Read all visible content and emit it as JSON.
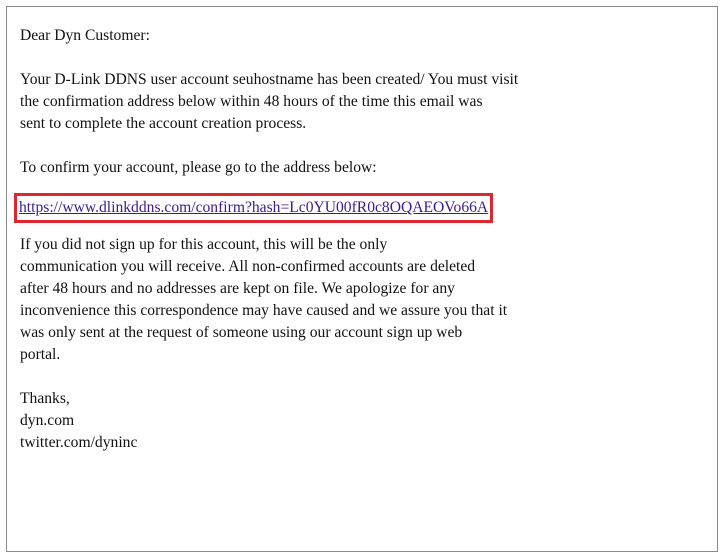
{
  "email": {
    "greeting": "Dear Dyn Customer:",
    "intro_lines": [
      "Your D-Link DDNS user account seuhostname has been created/ You must visit",
      "the confirmation address below within 48 hours of the time this email was",
      "sent to complete the account creation process."
    ],
    "instruction": "To confirm your account, please go to the address below:",
    "confirm_link": "https://www.dlinkddns.com/confirm?hash=Lc0YU00fR0c8OQAEOVo66A",
    "disclaimer_lines": [
      "If you did not sign up for this account, this will be the only",
      "communication you will receive. All non-confirmed accounts are deleted",
      "after 48 hours and no addresses are kept on file. We apologize for any",
      "inconvenience this correspondence may have caused and we assure you that it",
      "was only sent at the request of someone using our account sign up web",
      "portal."
    ],
    "signoff_lines": [
      "Thanks,",
      "dyn.com",
      "twitter.com/dyninc"
    ],
    "highlight_color": "#e0262e",
    "link_color": "#3d1a8f"
  }
}
